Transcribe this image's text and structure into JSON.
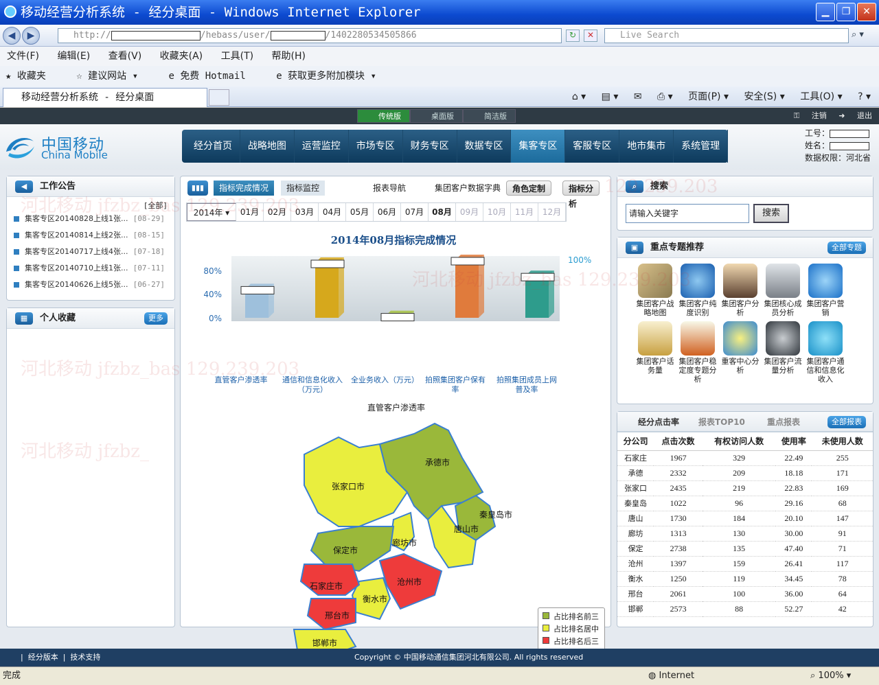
{
  "browser": {
    "title": "移动经营分析系统 - 经分桌面 - Windows Internet Explorer",
    "url_prefix": "http://",
    "url_mid": "/hebass/user/",
    "url_suffix": "/1402280534505866",
    "search_placeholder": "Live Search",
    "menu": [
      "文件(F)",
      "编辑(E)",
      "查看(V)",
      "收藏夹(A)",
      "工具(T)",
      "帮助(H)"
    ],
    "favorites": [
      "收藏夹",
      "建议网站 ▾",
      "免费 Hotmail",
      "获取更多附加模块 ▾"
    ],
    "tab_title": "移动经营分析系统 - 经分桌面",
    "commands": [
      "页面(P) ▾",
      "安全(S) ▾",
      "工具(O) ▾",
      "? ▾"
    ],
    "status_left": "完成",
    "status_zone": "Internet",
    "zoom": "100%"
  },
  "app": {
    "versions": [
      "传统版",
      "桌面版",
      "简洁版"
    ],
    "logout": "注销",
    "exit": "退出",
    "brand_cn": "中国移动",
    "brand_en": "China Mobile",
    "nav": [
      "经分首页",
      "战略地图",
      "运营监控",
      "市场专区",
      "财务专区",
      "数据专区",
      "集客专区",
      "客服专区",
      "地市集市",
      "系统管理"
    ],
    "user_id_label": "工号：",
    "user_name_label": "姓名：",
    "perm": "数据权限：河北省"
  },
  "notice": {
    "title": "工作公告",
    "all": "[全部]",
    "items": [
      {
        "text": "集客专区20140828上线1张...",
        "date": "[08-29]"
      },
      {
        "text": "集客专区20140814上线2张...",
        "date": "[08-15]"
      },
      {
        "text": "集客专区20140717上线4张...",
        "date": "[07-18]"
      },
      {
        "text": "集客专区20140710上线1张...",
        "date": "[07-11]"
      },
      {
        "text": "集客专区20140626上线5张...",
        "date": "[06-27]"
      }
    ]
  },
  "fav": {
    "title": "个人收藏",
    "more": "更多"
  },
  "center": {
    "tabs": [
      "指标完成情况",
      "指标监控"
    ],
    "links": [
      "报表导航",
      "集团客户数据字典"
    ],
    "btns": [
      "角色定制",
      "指标分析"
    ],
    "year": "2014年",
    "months": [
      "01月",
      "02月",
      "03月",
      "04月",
      "05月",
      "06月",
      "07月",
      "08月",
      "09月",
      "10月",
      "11月",
      "12月"
    ],
    "map_title": "直管客户渗透率",
    "cities": [
      "张家口市",
      "承德市",
      "秦皇岛市",
      "唐山市",
      "廊坊市",
      "保定市",
      "沧州市",
      "衡水市",
      "石家庄市",
      "邢台市",
      "邯郸市"
    ],
    "legend": [
      "占比排名前三",
      "占比排名居中",
      "占比排名后三"
    ],
    "legend_colors": [
      "#9ab83a",
      "#e9ee3e",
      "#ee3b3b"
    ]
  },
  "chart_data": {
    "type": "bar",
    "title": "2014年08月指标完成情况",
    "categories": [
      "直管客户渗透率",
      "通信和信息化收入（万元）",
      "全业务收入（万元）",
      "拍照集团客户保有率",
      "拍照集团成员上网普及率"
    ],
    "values": [
      52,
      100,
      3,
      105,
      76
    ],
    "yticks": [
      "0%",
      "40%",
      "80%",
      "100%"
    ],
    "ylim": [
      0,
      100
    ],
    "colors": [
      "#9ec0dc",
      "#d6a81c",
      "#a8c444",
      "#e07b3c",
      "#2e9c8c"
    ]
  },
  "search": {
    "title": "搜索",
    "placeholder": "请输入关键字",
    "button": "搜索"
  },
  "topics": {
    "title": "重点专题推荐",
    "all": "全部专题",
    "items": [
      "集团客户战略地图",
      "集团客户纯度识别",
      "集团客户分析",
      "集团核心成员分析",
      "集团客户营销",
      "集团客户话务量",
      "集团客户稳定度专题分析",
      "重客中心分析",
      "集团客户流量分析",
      "集团客户通信和信息化收入"
    ]
  },
  "ranking": {
    "tabs": [
      "经分点击率",
      "报表TOP10",
      "重点报表"
    ],
    "all": "全部报表",
    "headers": [
      "分公司",
      "点击次数",
      "有权访问人数",
      "使用率",
      "未使用人数"
    ],
    "rows": [
      [
        "石家庄",
        "1967",
        "329",
        "22.49",
        "255"
      ],
      [
        "承德",
        "2332",
        "209",
        "18.18",
        "171"
      ],
      [
        "张家口",
        "2435",
        "219",
        "22.83",
        "169"
      ],
      [
        "秦皇岛",
        "1022",
        "96",
        "29.16",
        "68"
      ],
      [
        "唐山",
        "1730",
        "184",
        "20.10",
        "147"
      ],
      [
        "廊坊",
        "1313",
        "130",
        "30.00",
        "91"
      ],
      [
        "保定",
        "2738",
        "135",
        "47.40",
        "71"
      ],
      [
        "沧州",
        "1397",
        "159",
        "26.41",
        "117"
      ],
      [
        "衡水",
        "1250",
        "119",
        "34.45",
        "78"
      ],
      [
        "邢台",
        "2061",
        "100",
        "36.00",
        "64"
      ],
      [
        "邯郸",
        "2573",
        "88",
        "52.27",
        "42"
      ]
    ]
  },
  "footer": {
    "links": [
      "经分版本",
      "技术支持"
    ],
    "copyright": "Copyright © 中国移动通信集团河北有限公司. All rights reserved"
  }
}
